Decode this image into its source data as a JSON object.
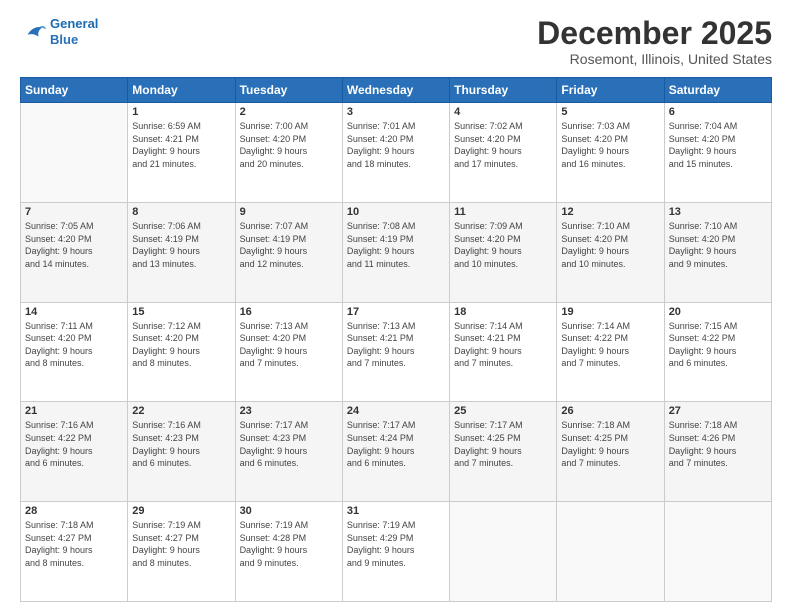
{
  "header": {
    "logo_line1": "General",
    "logo_line2": "Blue",
    "title": "December 2025",
    "subtitle": "Rosemont, Illinois, United States"
  },
  "days_of_week": [
    "Sunday",
    "Monday",
    "Tuesday",
    "Wednesday",
    "Thursday",
    "Friday",
    "Saturday"
  ],
  "weeks": [
    [
      {
        "num": "",
        "info": ""
      },
      {
        "num": "1",
        "info": "Sunrise: 6:59 AM\nSunset: 4:21 PM\nDaylight: 9 hours\nand 21 minutes."
      },
      {
        "num": "2",
        "info": "Sunrise: 7:00 AM\nSunset: 4:20 PM\nDaylight: 9 hours\nand 20 minutes."
      },
      {
        "num": "3",
        "info": "Sunrise: 7:01 AM\nSunset: 4:20 PM\nDaylight: 9 hours\nand 18 minutes."
      },
      {
        "num": "4",
        "info": "Sunrise: 7:02 AM\nSunset: 4:20 PM\nDaylight: 9 hours\nand 17 minutes."
      },
      {
        "num": "5",
        "info": "Sunrise: 7:03 AM\nSunset: 4:20 PM\nDaylight: 9 hours\nand 16 minutes."
      },
      {
        "num": "6",
        "info": "Sunrise: 7:04 AM\nSunset: 4:20 PM\nDaylight: 9 hours\nand 15 minutes."
      }
    ],
    [
      {
        "num": "7",
        "info": "Sunrise: 7:05 AM\nSunset: 4:20 PM\nDaylight: 9 hours\nand 14 minutes."
      },
      {
        "num": "8",
        "info": "Sunrise: 7:06 AM\nSunset: 4:19 PM\nDaylight: 9 hours\nand 13 minutes."
      },
      {
        "num": "9",
        "info": "Sunrise: 7:07 AM\nSunset: 4:19 PM\nDaylight: 9 hours\nand 12 minutes."
      },
      {
        "num": "10",
        "info": "Sunrise: 7:08 AM\nSunset: 4:19 PM\nDaylight: 9 hours\nand 11 minutes."
      },
      {
        "num": "11",
        "info": "Sunrise: 7:09 AM\nSunset: 4:20 PM\nDaylight: 9 hours\nand 10 minutes."
      },
      {
        "num": "12",
        "info": "Sunrise: 7:10 AM\nSunset: 4:20 PM\nDaylight: 9 hours\nand 10 minutes."
      },
      {
        "num": "13",
        "info": "Sunrise: 7:10 AM\nSunset: 4:20 PM\nDaylight: 9 hours\nand 9 minutes."
      }
    ],
    [
      {
        "num": "14",
        "info": "Sunrise: 7:11 AM\nSunset: 4:20 PM\nDaylight: 9 hours\nand 8 minutes."
      },
      {
        "num": "15",
        "info": "Sunrise: 7:12 AM\nSunset: 4:20 PM\nDaylight: 9 hours\nand 8 minutes."
      },
      {
        "num": "16",
        "info": "Sunrise: 7:13 AM\nSunset: 4:20 PM\nDaylight: 9 hours\nand 7 minutes."
      },
      {
        "num": "17",
        "info": "Sunrise: 7:13 AM\nSunset: 4:21 PM\nDaylight: 9 hours\nand 7 minutes."
      },
      {
        "num": "18",
        "info": "Sunrise: 7:14 AM\nSunset: 4:21 PM\nDaylight: 9 hours\nand 7 minutes."
      },
      {
        "num": "19",
        "info": "Sunrise: 7:14 AM\nSunset: 4:22 PM\nDaylight: 9 hours\nand 7 minutes."
      },
      {
        "num": "20",
        "info": "Sunrise: 7:15 AM\nSunset: 4:22 PM\nDaylight: 9 hours\nand 6 minutes."
      }
    ],
    [
      {
        "num": "21",
        "info": "Sunrise: 7:16 AM\nSunset: 4:22 PM\nDaylight: 9 hours\nand 6 minutes."
      },
      {
        "num": "22",
        "info": "Sunrise: 7:16 AM\nSunset: 4:23 PM\nDaylight: 9 hours\nand 6 minutes."
      },
      {
        "num": "23",
        "info": "Sunrise: 7:17 AM\nSunset: 4:23 PM\nDaylight: 9 hours\nand 6 minutes."
      },
      {
        "num": "24",
        "info": "Sunrise: 7:17 AM\nSunset: 4:24 PM\nDaylight: 9 hours\nand 6 minutes."
      },
      {
        "num": "25",
        "info": "Sunrise: 7:17 AM\nSunset: 4:25 PM\nDaylight: 9 hours\nand 7 minutes."
      },
      {
        "num": "26",
        "info": "Sunrise: 7:18 AM\nSunset: 4:25 PM\nDaylight: 9 hours\nand 7 minutes."
      },
      {
        "num": "27",
        "info": "Sunrise: 7:18 AM\nSunset: 4:26 PM\nDaylight: 9 hours\nand 7 minutes."
      }
    ],
    [
      {
        "num": "28",
        "info": "Sunrise: 7:18 AM\nSunset: 4:27 PM\nDaylight: 9 hours\nand 8 minutes."
      },
      {
        "num": "29",
        "info": "Sunrise: 7:19 AM\nSunset: 4:27 PM\nDaylight: 9 hours\nand 8 minutes."
      },
      {
        "num": "30",
        "info": "Sunrise: 7:19 AM\nSunset: 4:28 PM\nDaylight: 9 hours\nand 9 minutes."
      },
      {
        "num": "31",
        "info": "Sunrise: 7:19 AM\nSunset: 4:29 PM\nDaylight: 9 hours\nand 9 minutes."
      },
      {
        "num": "",
        "info": ""
      },
      {
        "num": "",
        "info": ""
      },
      {
        "num": "",
        "info": ""
      }
    ]
  ]
}
